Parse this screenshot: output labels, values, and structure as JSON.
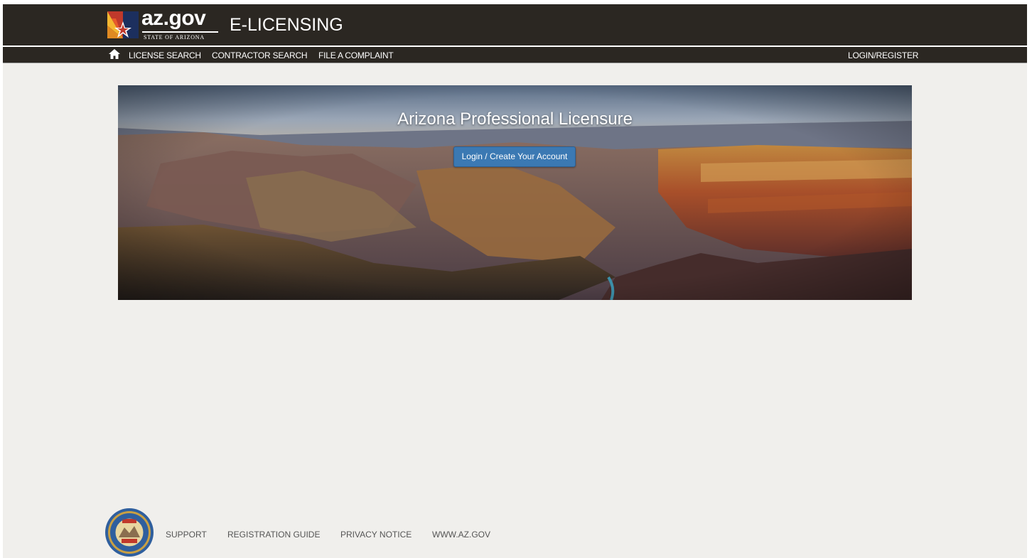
{
  "header": {
    "logo_text": "az.gov",
    "logo_subtext": "STATE OF ARIZONA",
    "app_title": "E-LICENSING"
  },
  "nav": {
    "home_icon": "home-icon",
    "links": [
      "LICENSE SEARCH",
      "CONTRACTOR SEARCH",
      "FILE A COMPLAINT"
    ],
    "login": "LOGIN/REGISTER"
  },
  "hero": {
    "title": "Arizona Professional Licensure",
    "button": "Login / Create Your Account"
  },
  "footer": {
    "seal": "arizona-state-seal",
    "links": [
      "SUPPORT",
      "REGISTRATION GUIDE",
      "PRIVACY NOTICE",
      "WWW.AZ.GOV"
    ]
  },
  "colors": {
    "header_bg": "#2b2722",
    "page_bg": "#f0efec",
    "button_bg": "#3b79b3",
    "footer_text": "#555555"
  }
}
